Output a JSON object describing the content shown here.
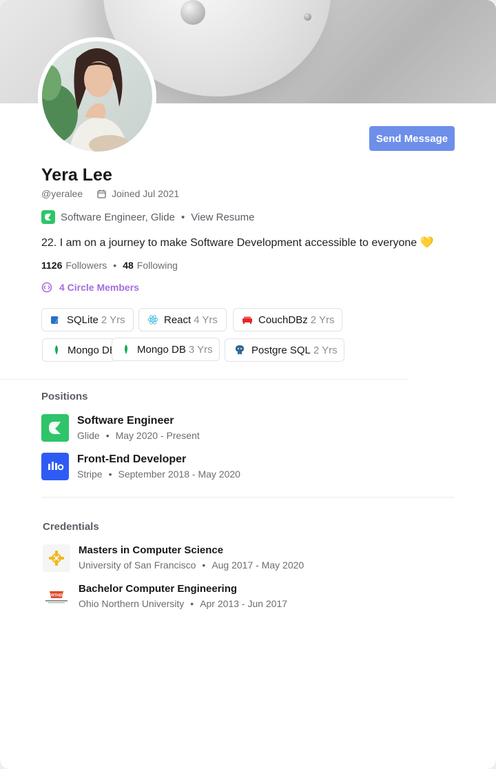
{
  "profile": {
    "name": "Yera Lee",
    "handle": "@yeralee",
    "joined": "Joined Jul 2021",
    "role": "Software Engineer, Glide",
    "resume_link": "View Resume",
    "bio": "22. I am on a journey to make Software Development accessible to everyone 💛",
    "followers_count": "1126",
    "followers_label": "Followers",
    "following_count": "48",
    "following_label": "Following",
    "circle": "4 Circle Members",
    "send_message": "Send Message"
  },
  "skills": [
    {
      "name": "SQLite",
      "years": "2 Yrs",
      "icon": "sqlite-icon"
    },
    {
      "name": "React",
      "years": "4 Yrs",
      "icon": "react-icon"
    },
    {
      "name": "CouchDBz",
      "years": "2 Yrs",
      "icon": "couchdb-icon"
    },
    {
      "name": "Mongo DB",
      "years": "",
      "icon": "mongodb-icon"
    },
    {
      "name": "Mongo DB",
      "years": "3 Yrs",
      "icon": "mongodb-icon"
    },
    {
      "name": "Postgre SQL",
      "years": "2 Yrs",
      "icon": "postgresql-icon"
    }
  ],
  "positions": {
    "title": "Positions",
    "items": [
      {
        "title": "Software Engineer",
        "company": "Glide",
        "dates": "May 2020 - Present",
        "logo": "glide-logo-icon"
      },
      {
        "title": "Front-End Developer",
        "company": "Stripe",
        "dates": "September 2018 - May 2020",
        "logo": "stripe-logo-icon"
      }
    ]
  },
  "credentials": {
    "title": "Credentials",
    "items": [
      {
        "title": "Masters in Computer Science",
        "school": "University of San Francisco",
        "dates": "Aug 2017 - May 2020",
        "logo": "usf-logo-icon"
      },
      {
        "title": "Bachelor Computer Engineering",
        "school": "Ohio Northern University",
        "dates": "Apr 2013 - Jun 2017",
        "logo": "onu-logo-icon",
        "logo_text": "NORTHERN"
      }
    ]
  },
  "colors": {
    "accent_button": "#6d8fea",
    "circle_purple": "#a66be0",
    "glide_green": "#2fc46a",
    "stripe_blue": "#2f5bf5"
  }
}
